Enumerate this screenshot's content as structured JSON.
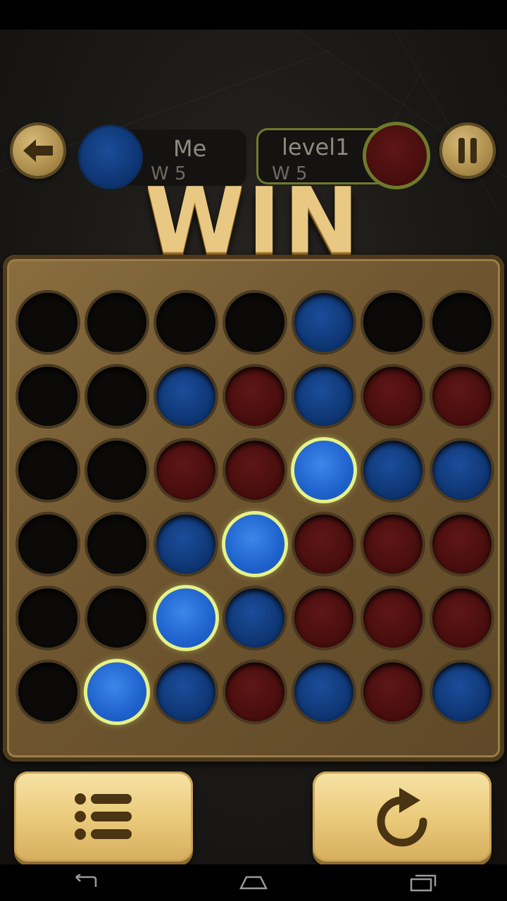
{
  "header": {
    "back_icon": "arrow-left-icon",
    "pause_icon": "pause-icon"
  },
  "players": {
    "me": {
      "name": "Me",
      "wins": "W 5",
      "color": "#0f3775"
    },
    "opponent": {
      "name": "level1",
      "wins": "W 5",
      "color": "#4a0e0e"
    }
  },
  "banner": {
    "text": "WIN"
  },
  "board": {
    "rows": 6,
    "cols": 7,
    "cells": [
      [
        "empty",
        "empty",
        "empty",
        "empty",
        "blue",
        "empty",
        "empty"
      ],
      [
        "empty",
        "empty",
        "blue",
        "red",
        "blue",
        "red",
        "red"
      ],
      [
        "empty",
        "empty",
        "red",
        "red",
        "blue-win",
        "blue",
        "blue"
      ],
      [
        "empty",
        "empty",
        "blue",
        "blue-win",
        "red",
        "red",
        "red"
      ],
      [
        "empty",
        "empty",
        "blue-win",
        "blue",
        "red",
        "red",
        "red"
      ],
      [
        "empty",
        "blue-win",
        "blue",
        "red",
        "blue",
        "red",
        "blue"
      ]
    ],
    "colors": {
      "blue": "#0f3775",
      "red": "#4a0e0e",
      "win_ring": "#e5f28a"
    }
  },
  "bottom": {
    "menu_icon": "list-menu-icon",
    "restart_icon": "restart-icon"
  },
  "navbar": {
    "back_icon": "nav-back-icon",
    "home_icon": "nav-home-icon",
    "recents_icon": "nav-recents-icon"
  }
}
